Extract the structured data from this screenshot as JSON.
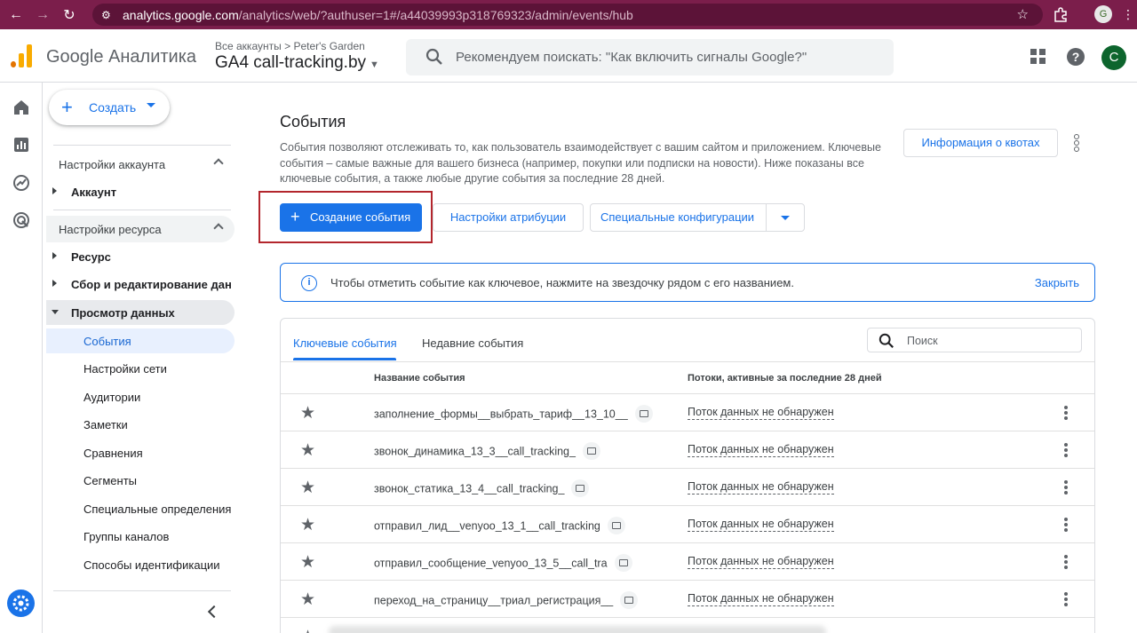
{
  "browser": {
    "url_host": "analytics.google.com",
    "url_path": "/analytics/web/?authuser=1#/a44039993p318769323/admin/events/hub",
    "profile_initial": "G"
  },
  "header": {
    "brand": "Google Аналитика",
    "breadcrumb_all": "Все аккаунты",
    "breadcrumb_sep": ">",
    "breadcrumb_account": "Peter's Garden",
    "property": "GA4 call-tracking.by",
    "search_placeholder": "Рекомендуем поискать: \"Как включить сигналы Google?\"",
    "avatar_initial": "C"
  },
  "nav": {
    "create_label": "Создать",
    "account_section": "Настройки аккаунта",
    "account_item": "Аккаунт",
    "property_section": "Настройки ресурса",
    "items": [
      "Ресурс",
      "Сбор и редактирование данных",
      "Просмотр данных"
    ],
    "sub_items": [
      "События",
      "Настройки сети",
      "Аудитории",
      "Заметки",
      "Сравнения",
      "Сегменты",
      "Специальные определения",
      "Группы каналов",
      "Способы идентификации"
    ]
  },
  "main": {
    "title": "События",
    "description": "События позволяют отслеживать то, как пользователь взаимодействует с вашим сайтом и приложением. Ключевые события – самые важные для вашего бизнеса (например, покупки или подписки на новости). Ниже показаны все ключевые события, а также любые другие события за последние 28 дней.",
    "quota_button": "Информация о квотах",
    "create_event_button": "Создание события",
    "attribution_button": "Настройки атрибуции",
    "custom_config_button": "Специальные конфигурации",
    "banner_text": "Чтобы отметить событие как ключевое, нажмите на звездочку рядом с его названием.",
    "banner_close": "Закрыть",
    "tabs": [
      "Ключевые события",
      "Недавние события"
    ],
    "table_search_placeholder": "Поиск",
    "columns": [
      "Название события",
      "Потоки, активные за последние 28 дней"
    ],
    "rows": [
      {
        "name": "заполнение_формы__выбрать_тариф__13_10__",
        "stream": "Поток данных не обнаружен"
      },
      {
        "name": "звонок_динамика_13_3__call_tracking_",
        "stream": "Поток данных не обнаружен"
      },
      {
        "name": "звонок_статика_13_4__call_tracking_",
        "stream": "Поток данных не обнаружен"
      },
      {
        "name": "отправил_лид__venyoo_13_1__call_tracking",
        "stream": "Поток данных не обнаружен"
      },
      {
        "name": "отправил_сообщение_venyoo_13_5__call_tra",
        "stream": "Поток данных не обнаружен"
      },
      {
        "name": "переход_на_страницу__триал_регистрация__",
        "stream": "Поток данных не обнаружен"
      }
    ]
  },
  "colors": {
    "chrome": "#7b1e4b",
    "accent": "#1a73e8",
    "highlight": "#b3262d"
  }
}
